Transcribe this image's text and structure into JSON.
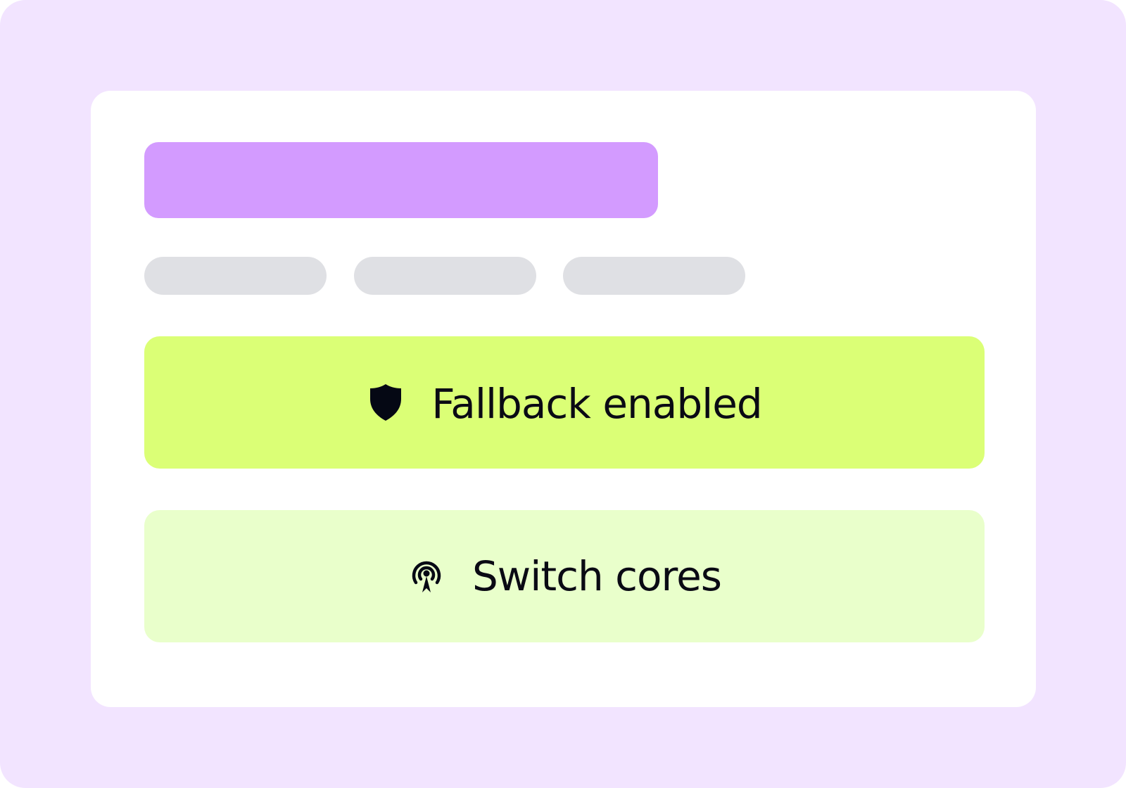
{
  "colors": {
    "background": "#f2e4ff",
    "card": "#ffffff",
    "title_placeholder": "#d39bff",
    "pill_placeholder": "#dfe0e4",
    "primary_action": "#dbff76",
    "secondary_action": "#e9ffcb",
    "text": "#0a0a14"
  },
  "actions": [
    {
      "icon": "shield-icon",
      "label": "Fallback enabled"
    },
    {
      "icon": "broadcast-tower-icon",
      "label": "Switch cores"
    }
  ]
}
